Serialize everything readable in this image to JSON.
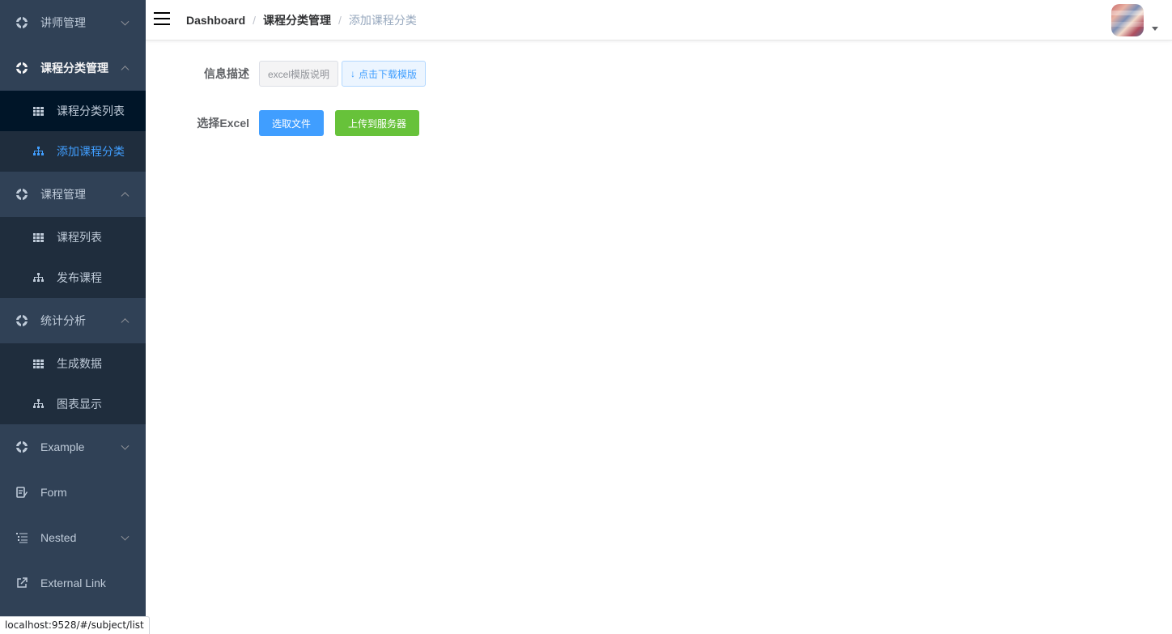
{
  "sidebar": {
    "items": [
      {
        "label": "讲师管理",
        "icon": "ring-icon",
        "expanded": false
      },
      {
        "label": "课程分类管理",
        "icon": "ring-icon",
        "expanded": true,
        "children": [
          {
            "label": "课程分类列表",
            "icon": "table-icon"
          },
          {
            "label": "添加课程分类",
            "icon": "tree-icon",
            "active": true
          }
        ]
      },
      {
        "label": "课程管理",
        "icon": "ring-icon",
        "expanded": true,
        "children": [
          {
            "label": "课程列表",
            "icon": "table-icon"
          },
          {
            "label": "发布课程",
            "icon": "tree-icon"
          }
        ]
      },
      {
        "label": "统计分析",
        "icon": "ring-icon",
        "expanded": true,
        "children": [
          {
            "label": "生成数据",
            "icon": "table-icon"
          },
          {
            "label": "图表显示",
            "icon": "tree-icon"
          }
        ]
      },
      {
        "label": "Example",
        "icon": "ring-icon",
        "expanded": false
      },
      {
        "label": "Form",
        "icon": "form-icon"
      },
      {
        "label": "Nested",
        "icon": "nested-icon",
        "expanded": false
      },
      {
        "label": "External Link",
        "icon": "external-link-icon"
      }
    ]
  },
  "navbar": {
    "breadcrumb": [
      "Dashboard",
      "课程分类管理",
      "添加课程分类"
    ],
    "separator": "/"
  },
  "form": {
    "info_label": "信息描述",
    "template_tag": "excel模版说明",
    "download_icon": "↓",
    "download_label": "点击下载模版",
    "excel_label": "选择Excel",
    "select_file_label": "选取文件",
    "upload_label": "上传到服务器"
  },
  "status_bar": {
    "url": "localhost:9528/#/subject/list"
  },
  "colors": {
    "sidebar_bg": "#304156",
    "submenu_bg": "#1f2d3d",
    "active_text": "#409eff",
    "primary": "#409eff",
    "success": "#67c23a"
  }
}
